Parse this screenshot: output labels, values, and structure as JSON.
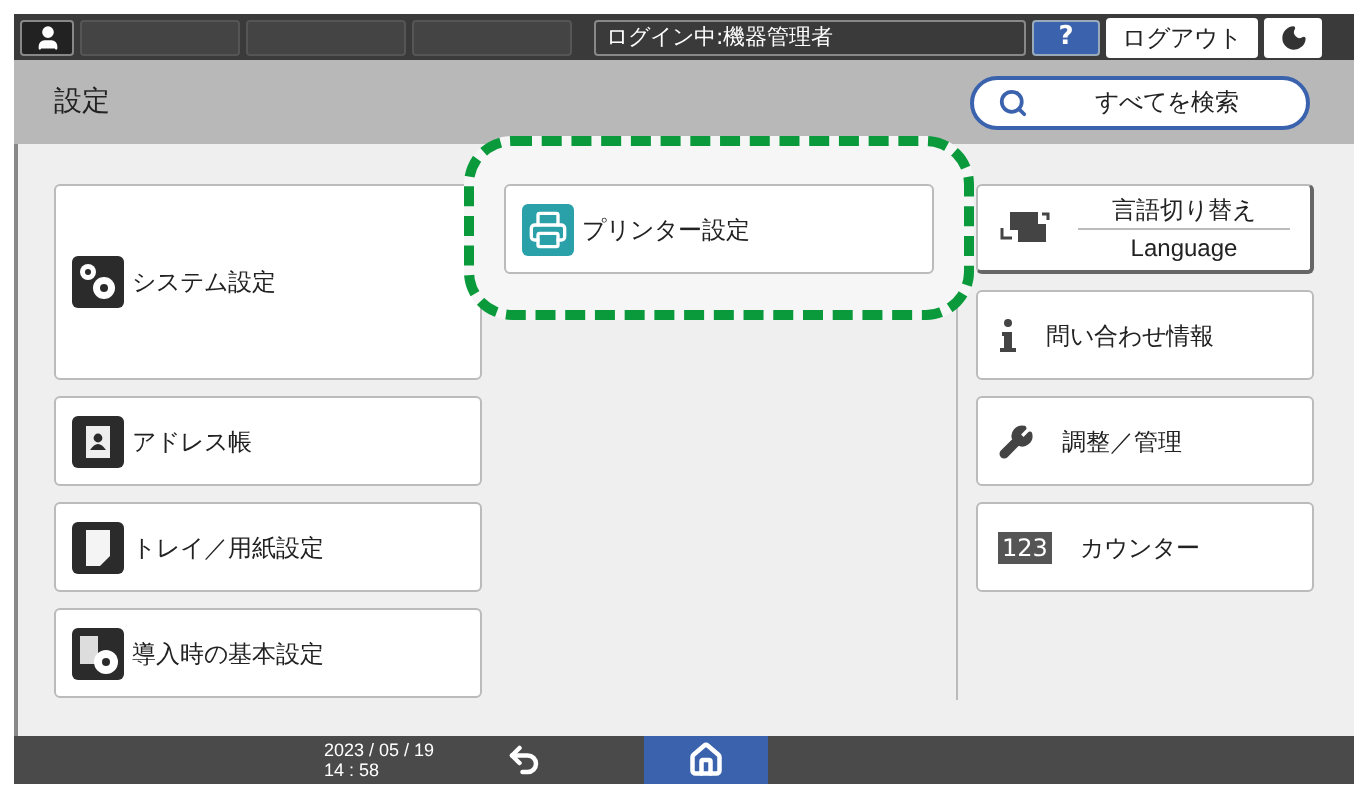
{
  "top_bar": {
    "login_status": "ログイン中:機器管理者",
    "help": "?",
    "logout": "ログアウト"
  },
  "header": {
    "title": "設定",
    "search_button": "すべてを検索"
  },
  "left_items": [
    {
      "kind": "system",
      "label": "システム設定"
    },
    {
      "kind": "address",
      "label": "アドレス帳"
    },
    {
      "kind": "tray",
      "label": "トレイ／用紙設定"
    },
    {
      "kind": "initial",
      "label": "導入時の基本設定"
    }
  ],
  "center_items": [
    {
      "kind": "printer",
      "label": "プリンター設定",
      "highlighted": true
    }
  ],
  "right_items": [
    {
      "kind": "language",
      "label": "言語切り替え",
      "sublabel": "Language"
    },
    {
      "kind": "info",
      "label": "問い合わせ情報"
    },
    {
      "kind": "adjust",
      "label": "調整／管理"
    },
    {
      "kind": "counter",
      "label": "カウンター",
      "icon_text": "123"
    }
  ],
  "bottom_bar": {
    "date": "2023 / 05 / 19",
    "time": "14 : 58"
  }
}
